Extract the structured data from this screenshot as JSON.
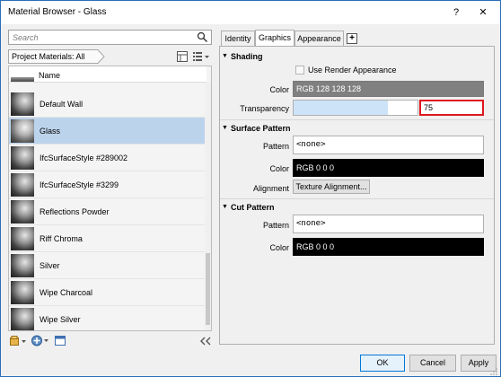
{
  "window": {
    "title": "Material Browser - Glass",
    "help": "?",
    "close": "✕"
  },
  "search": {
    "placeholder": "Search"
  },
  "filter": {
    "label": "Project Materials: All"
  },
  "list": {
    "header": "Name",
    "items": [
      {
        "label": "Default Wall",
        "selected": false
      },
      {
        "label": "Glass",
        "selected": true
      },
      {
        "label": "IfcSurfaceStyle #289002",
        "selected": false
      },
      {
        "label": "IfcSurfaceStyle #3299",
        "selected": false
      },
      {
        "label": "Reflections Powder",
        "selected": false
      },
      {
        "label": "Riff Chroma",
        "selected": false
      },
      {
        "label": "Silver",
        "selected": false
      },
      {
        "label": "Wipe Charcoal",
        "selected": false
      },
      {
        "label": "Wipe Silver",
        "selected": false
      }
    ]
  },
  "tabs": [
    {
      "label": "Identity",
      "active": false
    },
    {
      "label": "Graphics",
      "active": true
    },
    {
      "label": "Appearance",
      "active": false
    }
  ],
  "add_tab": "+",
  "shading": {
    "title": "Shading",
    "use_render_appearance": "Use Render Appearance",
    "color_label": "Color",
    "color_value": "RGB 128 128 128",
    "color_hex": "#808080",
    "transparency_label": "Transparency",
    "transparency_value": "75",
    "transparency_fraction": 0.75
  },
  "surface_pattern": {
    "title": "Surface Pattern",
    "pattern_label": "Pattern",
    "pattern_value": "<none>",
    "color_label": "Color",
    "color_value": "RGB 0 0 0",
    "alignment_label": "Alignment",
    "alignment_button": "Texture Alignment..."
  },
  "cut_pattern": {
    "title": "Cut Pattern",
    "pattern_label": "Pattern",
    "pattern_value": "<none>",
    "color_label": "Color",
    "color_value": "RGB 0 0 0"
  },
  "buttons": {
    "ok": "OK",
    "cancel": "Cancel",
    "apply": "Apply"
  },
  "colors": {
    "selection": "#bcd3ec",
    "highlight_border": "#e0161e",
    "transparency_fill": "#cde3f7"
  }
}
